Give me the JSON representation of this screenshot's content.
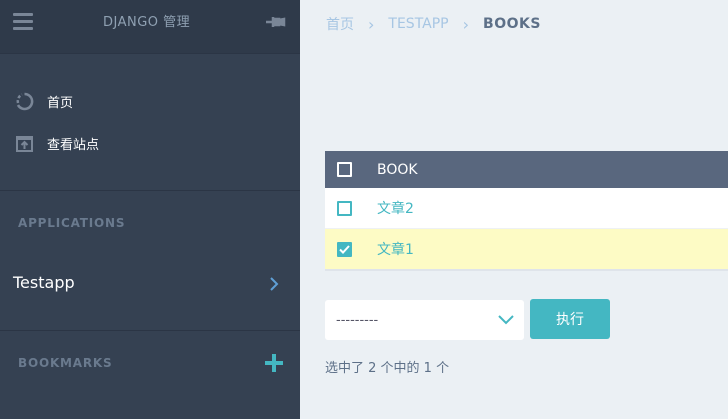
{
  "sidebar": {
    "app_title": "DJANGO 管理",
    "nav": [
      {
        "label": "首页",
        "icon": "dashboard-icon"
      },
      {
        "label": "查看站点",
        "icon": "open-in-new-icon"
      }
    ],
    "applications_title": "APPLICATIONS",
    "app_item": "Testapp",
    "bookmarks_title": "BOOKMARKS"
  },
  "breadcrumb": {
    "home": "首页",
    "app": "TESTAPP",
    "current": "BOOKS"
  },
  "table": {
    "header": "BOOK",
    "rows": [
      {
        "label": "文章2",
        "checked": false
      },
      {
        "label": "文章1",
        "checked": true
      }
    ]
  },
  "actions": {
    "selected": "---------",
    "go_label": "执行",
    "counter": "选中了 2 个中的 1 个"
  },
  "colors": {
    "sidebar": "#354152",
    "accent": "#44b7c2",
    "table_header": "#59677e",
    "selected_row": "#fdfbc5",
    "background": "#ebf0f4"
  }
}
